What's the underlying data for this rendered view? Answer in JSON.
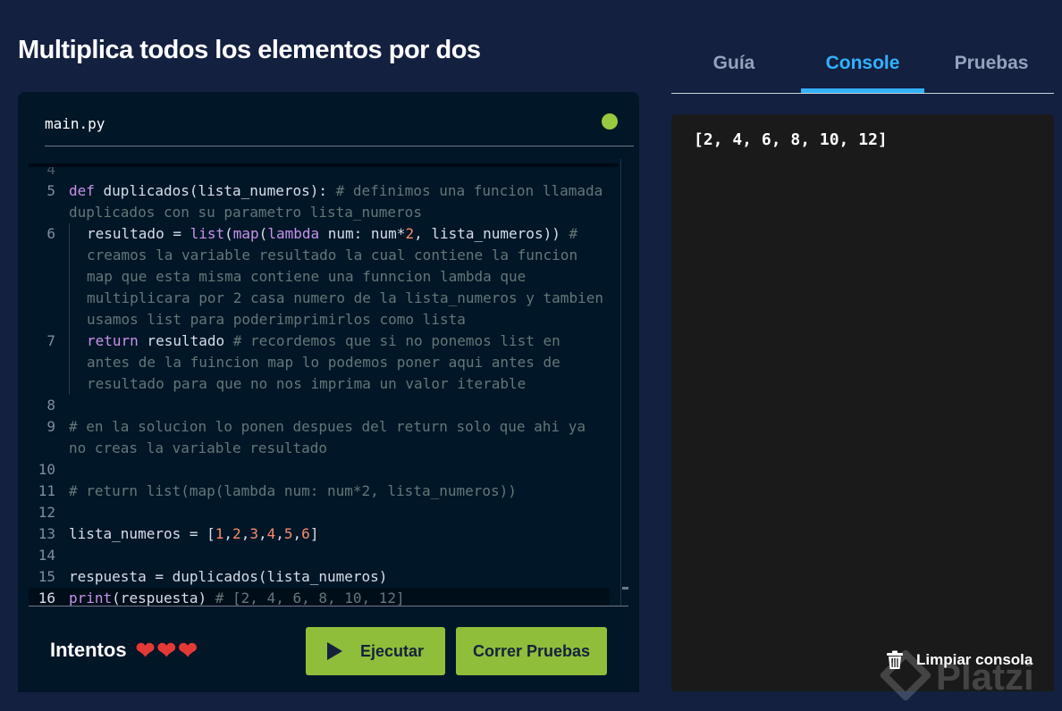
{
  "title": "Multiplica todos los elementos por dos",
  "editor": {
    "file_name": "main.py",
    "lines": [
      {
        "num": "4",
        "dim": true,
        "indent": false,
        "tokens": []
      },
      {
        "num": "5",
        "indent": false,
        "tokens": [
          {
            "t": "kw",
            "v": "def"
          },
          {
            "t": "plain",
            "v": " duplicados(lista_numeros): "
          },
          {
            "t": "cm",
            "v": "# definimos una funcion llamada duplicados con su parametro lista_numeros"
          }
        ]
      },
      {
        "num": "6",
        "indent": true,
        "tokens": [
          {
            "t": "plain",
            "v": "resultado = "
          },
          {
            "t": "fn",
            "v": "list"
          },
          {
            "t": "plain",
            "v": "("
          },
          {
            "t": "fn",
            "v": "map"
          },
          {
            "t": "plain",
            "v": "("
          },
          {
            "t": "kw",
            "v": "lambda"
          },
          {
            "t": "plain",
            "v": " num: num*"
          },
          {
            "t": "num",
            "v": "2"
          },
          {
            "t": "plain",
            "v": ", lista_numeros)) "
          },
          {
            "t": "cm",
            "v": "# creamos la variable resultado la cual contiene la funcion map que esta misma contiene una funncion lambda que multiplicara por 2 casa numero de la lista_numeros y tambien usamos list para poderimprimirlos como lista"
          }
        ]
      },
      {
        "num": "7",
        "indent": true,
        "tokens": [
          {
            "t": "kw",
            "v": "return"
          },
          {
            "t": "plain",
            "v": " resultado "
          },
          {
            "t": "cm",
            "v": "# recordemos que si no ponemos list en antes de la fuincion map lo podemos poner aqui antes de resultado para que no nos imprima un valor iterable"
          }
        ]
      },
      {
        "num": "8",
        "indent": false,
        "tokens": []
      },
      {
        "num": "9",
        "indent": false,
        "tokens": [
          {
            "t": "cm",
            "v": "# en la solucion lo ponen despues del return solo que ahi ya no creas la variable resultado"
          }
        ]
      },
      {
        "num": "10",
        "indent": false,
        "tokens": []
      },
      {
        "num": "11",
        "indent": false,
        "tokens": [
          {
            "t": "cm",
            "v": "# return list(map(lambda num: num*2, lista_numeros))"
          }
        ]
      },
      {
        "num": "12",
        "indent": false,
        "tokens": []
      },
      {
        "num": "13",
        "indent": false,
        "tokens": [
          {
            "t": "plain",
            "v": "lista_numeros = ["
          },
          {
            "t": "num",
            "v": "1"
          },
          {
            "t": "plain",
            "v": ","
          },
          {
            "t": "num",
            "v": "2"
          },
          {
            "t": "plain",
            "v": ","
          },
          {
            "t": "num",
            "v": "3"
          },
          {
            "t": "plain",
            "v": ","
          },
          {
            "t": "num",
            "v": "4"
          },
          {
            "t": "plain",
            "v": ","
          },
          {
            "t": "num",
            "v": "5"
          },
          {
            "t": "plain",
            "v": ","
          },
          {
            "t": "num",
            "v": "6"
          },
          {
            "t": "plain",
            "v": "]"
          }
        ]
      },
      {
        "num": "14",
        "indent": false,
        "tokens": []
      },
      {
        "num": "15",
        "indent": false,
        "tokens": [
          {
            "t": "plain",
            "v": "respuesta = duplicados(lista_numeros)"
          }
        ]
      },
      {
        "num": "16",
        "indent": false,
        "current": true,
        "tokens": [
          {
            "t": "fn",
            "v": "print"
          },
          {
            "t": "plain",
            "v": "(respuesta) "
          },
          {
            "t": "cm",
            "v": "# [2, 4, 6, 8, 10, 12]"
          }
        ]
      }
    ]
  },
  "attempts": {
    "label": "Intentos",
    "hearts": [
      "❤",
      "❤",
      "❤"
    ]
  },
  "buttons": {
    "run": "Ejecutar",
    "tests": "Correr Pruebas"
  },
  "tabs": {
    "guia": "Guía",
    "console": "Console",
    "pruebas": "Pruebas"
  },
  "console": {
    "output": "[2, 4, 6, 8, 10, 12]",
    "clear": "Limpiar consola"
  },
  "watermark": "Platzi",
  "colors": {
    "accent": "#33b1ff",
    "button": "#8fbe3a",
    "status_dot": "#98ca3f",
    "heart": "#e53935"
  },
  "icons": {
    "run": "play-icon",
    "clear": "trash-icon",
    "status": "status-dot-icon",
    "attempt": "heart-icon"
  }
}
